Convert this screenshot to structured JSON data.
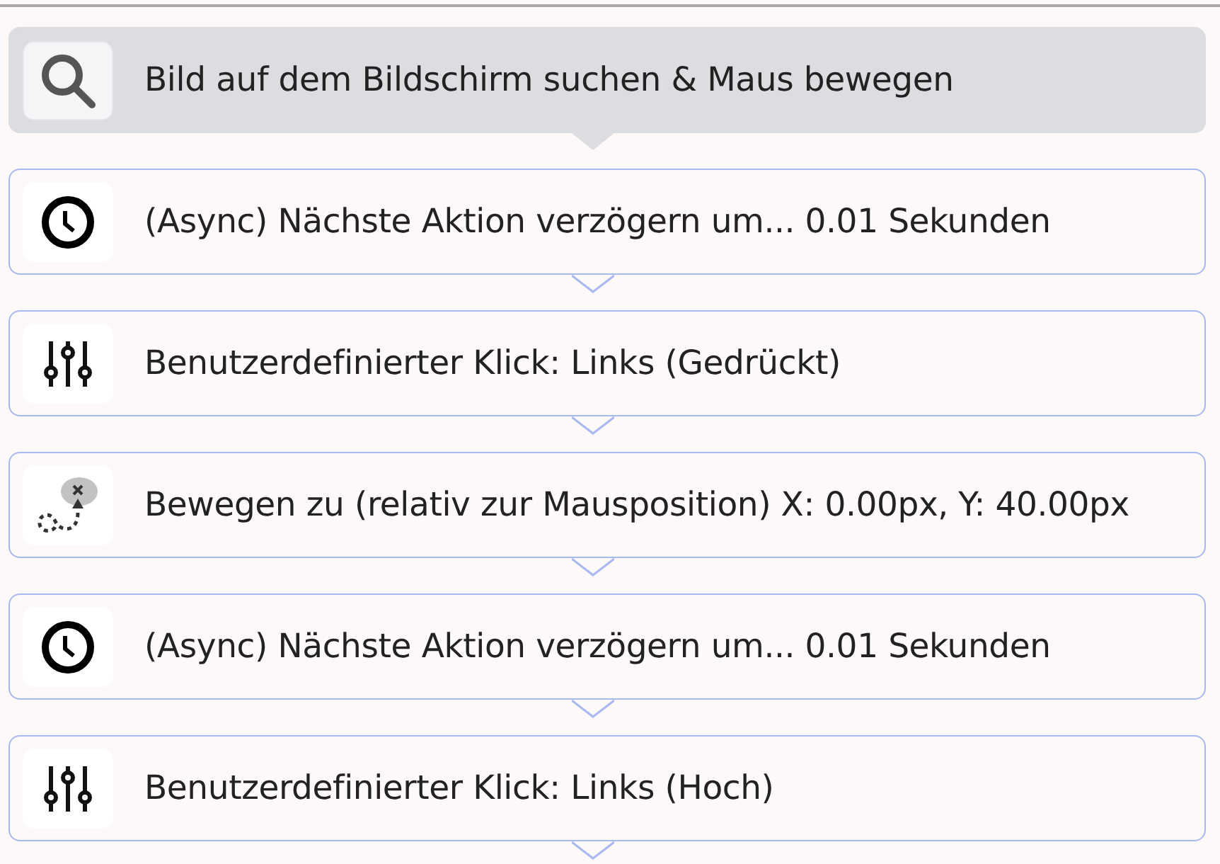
{
  "steps": [
    {
      "kind": "search",
      "label": "Bild auf dem Bildschirm suchen & Maus bewegen",
      "selected": true
    },
    {
      "kind": "delay",
      "label": "(Async) Nächste Aktion verzögern um... 0.01 Sekunden",
      "selected": false
    },
    {
      "kind": "click",
      "label": "Benutzerdefinierter Klick: Links (Gedrückt)",
      "selected": false
    },
    {
      "kind": "move",
      "label": "Bewegen zu (relativ zur Mausposition) X: 0.00px, Y: 40.00px",
      "selected": false
    },
    {
      "kind": "delay",
      "label": "(Async) Nächste Aktion verzögern um... 0.01 Sekunden",
      "selected": false
    },
    {
      "kind": "click",
      "label": "Benutzerdefinierter Klick: Links (Hoch)",
      "selected": false
    }
  ]
}
